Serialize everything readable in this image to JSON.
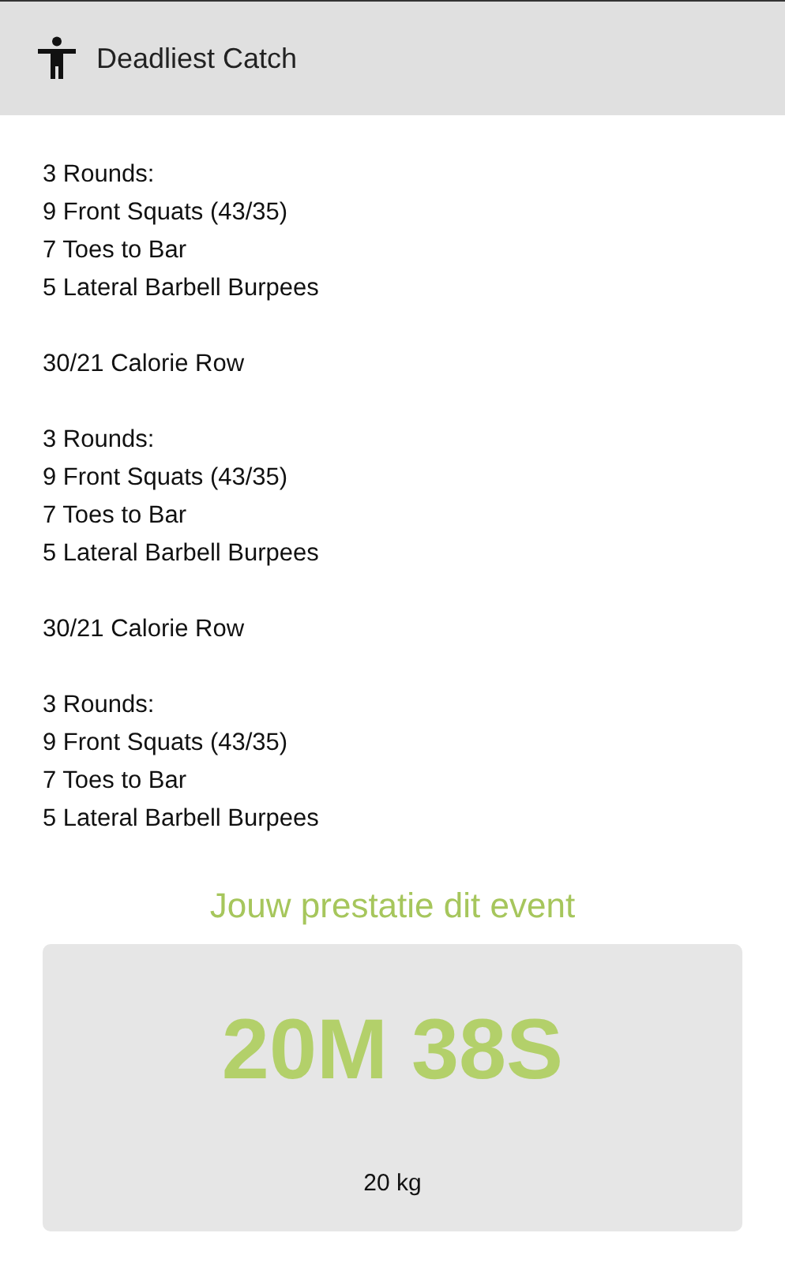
{
  "header": {
    "title": "Deadliest Catch"
  },
  "workout": [
    {
      "lines": [
        "3 Rounds:",
        "9 Front Squats (43/35)",
        "7 Toes to Bar",
        "5 Lateral Barbell Burpees"
      ]
    },
    {
      "lines": [
        "30/21 Calorie Row"
      ]
    },
    {
      "lines": [
        "3 Rounds:",
        "9 Front Squats (43/35)",
        "7 Toes to Bar",
        "5 Lateral Barbell Burpees"
      ]
    },
    {
      "lines": [
        "30/21 Calorie Row"
      ]
    },
    {
      "lines": [
        "3 Rounds:",
        "9 Front Squats (43/35)",
        "7 Toes to Bar",
        "5 Lateral Barbell Burpees"
      ]
    }
  ],
  "performance": {
    "heading": "Jouw prestatie dit event",
    "result": "20M 38S",
    "weight": "20 kg"
  }
}
